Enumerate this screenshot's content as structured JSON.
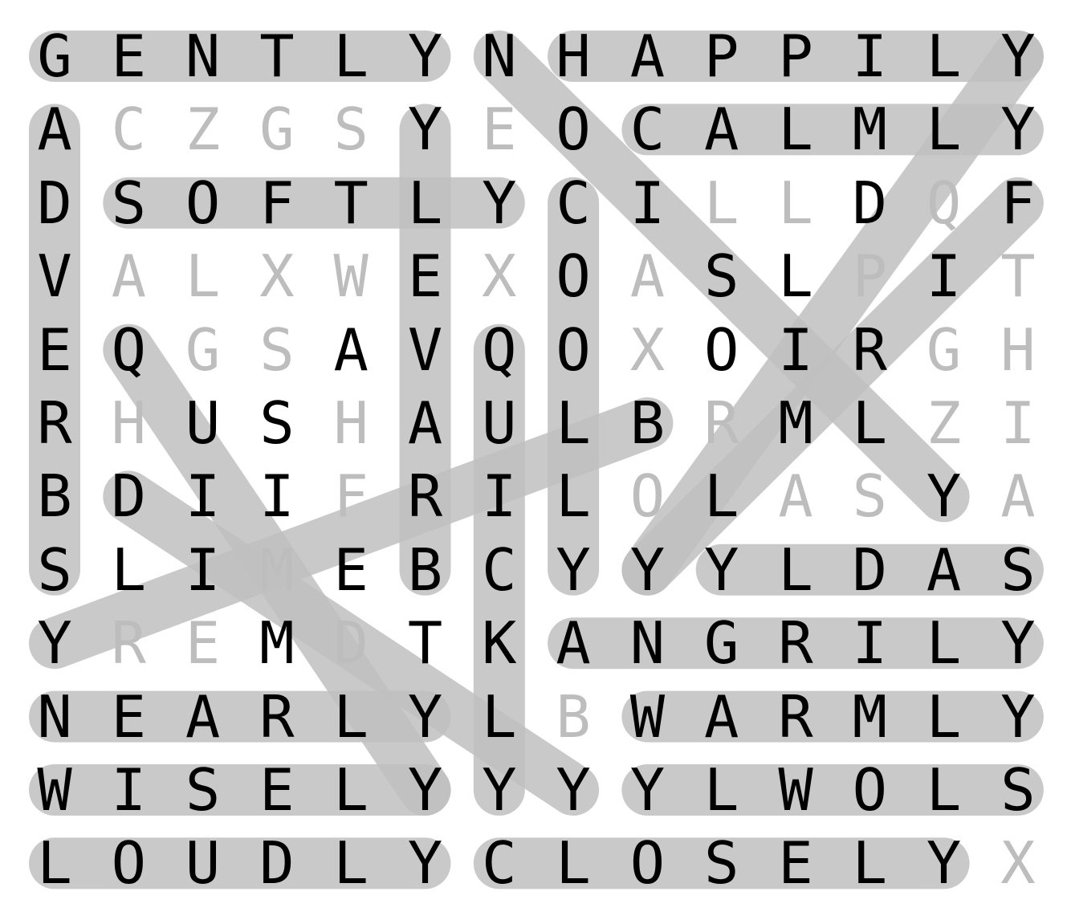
{
  "puzzle": {
    "grid": [
      "GENTLYNHAPPILY",
      "ACZGSYEOCALMLY",
      "DSOFTLYCILLDQF",
      "VALXWEXOASLPIT",
      "EQGSAVQOXOIRGH",
      "RHUSHAULBRMLZI",
      "BDIIFRILOLASYA",
      "SLIMEBCYYYLDAS",
      "YREMDTKANGRILY",
      "NEARLYLBWARMLY",
      "WISELYYYYLWOLS",
      "LOUDLYCLOSELYX"
    ],
    "found_words": [
      {
        "word": "GENTLY",
        "start": [
          0,
          0
        ],
        "end": [
          0,
          5
        ]
      },
      {
        "word": "HAPPILY",
        "start": [
          0,
          7
        ],
        "end": [
          0,
          13
        ]
      },
      {
        "word": "CALMLY",
        "start": [
          1,
          8
        ],
        "end": [
          1,
          13
        ]
      },
      {
        "word": "SOFTLY",
        "start": [
          2,
          1
        ],
        "end": [
          2,
          6
        ]
      },
      {
        "word": "SADLY",
        "start": [
          7,
          13
        ],
        "end": [
          7,
          9
        ]
      },
      {
        "word": "ANGRILY",
        "start": [
          8,
          7
        ],
        "end": [
          8,
          13
        ]
      },
      {
        "word": "NEARLY",
        "start": [
          9,
          0
        ],
        "end": [
          9,
          5
        ]
      },
      {
        "word": "WARMLY",
        "start": [
          9,
          8
        ],
        "end": [
          9,
          13
        ]
      },
      {
        "word": "WISELY",
        "start": [
          10,
          0
        ],
        "end": [
          10,
          5
        ]
      },
      {
        "word": "SLOWLY",
        "start": [
          10,
          13
        ],
        "end": [
          10,
          8
        ]
      },
      {
        "word": "LOUDLY",
        "start": [
          11,
          0
        ],
        "end": [
          11,
          5
        ]
      },
      {
        "word": "CLOSELY",
        "start": [
          11,
          6
        ],
        "end": [
          11,
          12
        ]
      },
      {
        "word": "ADVERBS",
        "start": [
          1,
          0
        ],
        "end": [
          7,
          0
        ]
      },
      {
        "word": "YLEVARB",
        "start": [
          1,
          5
        ],
        "end": [
          7,
          5
        ]
      },
      {
        "word": "COOLLY",
        "start": [
          2,
          7
        ],
        "end": [
          7,
          7
        ]
      },
      {
        "word": "QUICKLY",
        "start": [
          4,
          6
        ],
        "end": [
          10,
          6
        ]
      },
      {
        "word": "NOISILY",
        "start": [
          0,
          6
        ],
        "end": [
          6,
          12
        ]
      },
      {
        "word": "YLLIRRAB",
        "start": [
          0,
          13
        ],
        "end": [
          7,
          8
        ]
      },
      {
        "word": "FIRMLY",
        "start": [
          2,
          13
        ],
        "end": [
          7,
          8
        ]
      },
      {
        "word": "BRAVELY",
        "start": [
          5,
          8
        ],
        "end": [
          8,
          0
        ]
      },
      {
        "word": "QUIETLY",
        "start": [
          4,
          1
        ],
        "end": [
          10,
          5
        ]
      },
      {
        "word": "DIMLY",
        "start": [
          6,
          1
        ],
        "end": [
          10,
          7
        ]
      }
    ],
    "dim_cells": [
      [
        1,
        1
      ],
      [
        1,
        2
      ],
      [
        1,
        3
      ],
      [
        1,
        4
      ],
      [
        1,
        6
      ],
      [
        2,
        9
      ],
      [
        2,
        10
      ],
      [
        2,
        12
      ],
      [
        3,
        1
      ],
      [
        3,
        2
      ],
      [
        3,
        3
      ],
      [
        3,
        4
      ],
      [
        3,
        6
      ],
      [
        3,
        8
      ],
      [
        3,
        11
      ],
      [
        3,
        13
      ],
      [
        4,
        2
      ],
      [
        4,
        3
      ],
      [
        4,
        8
      ],
      [
        4,
        12
      ],
      [
        4,
        13
      ],
      [
        5,
        1
      ],
      [
        5,
        4
      ],
      [
        5,
        9
      ],
      [
        5,
        12
      ],
      [
        5,
        13
      ],
      [
        6,
        4
      ],
      [
        6,
        8
      ],
      [
        6,
        10
      ],
      [
        6,
        11
      ],
      [
        6,
        13
      ],
      [
        7,
        3
      ],
      [
        8,
        1
      ],
      [
        8,
        2
      ],
      [
        8,
        4
      ],
      [
        9,
        7
      ],
      [
        11,
        13
      ]
    ],
    "colors": {
      "letter": "#000000",
      "dim_letter": "#bdbdbd",
      "highlight": "#c0c0c0",
      "background": "#ffffff"
    }
  }
}
